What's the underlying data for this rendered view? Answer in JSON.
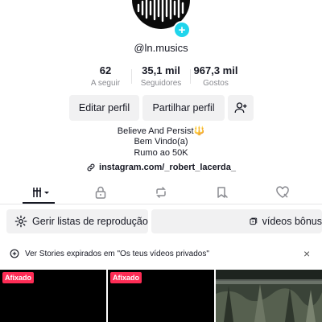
{
  "profile": {
    "username": "@ln.musics",
    "add_badge": "+"
  },
  "stats": [
    {
      "value": "62",
      "label": "A seguir"
    },
    {
      "value": "35,1 mil",
      "label": "Seguidores"
    },
    {
      "value": "967,3 mil",
      "label": "Gostos"
    }
  ],
  "actions": {
    "edit_profile": "Editar perfil",
    "share_profile": "Partilhar perfil",
    "add_friend_icon": "person-plus-icon"
  },
  "bio": {
    "line1": "Believe And Persist🔱",
    "line2": "Bem Vindo(a)",
    "line3": "Rumo ao 50K"
  },
  "link": {
    "icon": "link-icon",
    "text": "instagram.com/_robert_lacerda_"
  },
  "tabs": [
    {
      "icon": "videos-grid-icon",
      "active": true
    },
    {
      "icon": "lock-icon",
      "active": false
    },
    {
      "icon": "repost-icon",
      "active": false
    },
    {
      "icon": "bookmark-icon",
      "active": false
    },
    {
      "icon": "liked-heart-icon",
      "active": false
    }
  ],
  "playlists": {
    "manage_label": "Gerir listas de reprodução",
    "bonus_label": "vídeos bônus"
  },
  "stories": {
    "text": "Ver Stories expirados em \"Os teus vídeos privados\"",
    "close": "×"
  },
  "grid": {
    "pinned_label_1": "Afixado",
    "pinned_label_2": "Afixado"
  },
  "colors": {
    "accent": "#fe2c55",
    "plus_badge": "#20d5ec",
    "button_bg": "#f1f1f2"
  }
}
